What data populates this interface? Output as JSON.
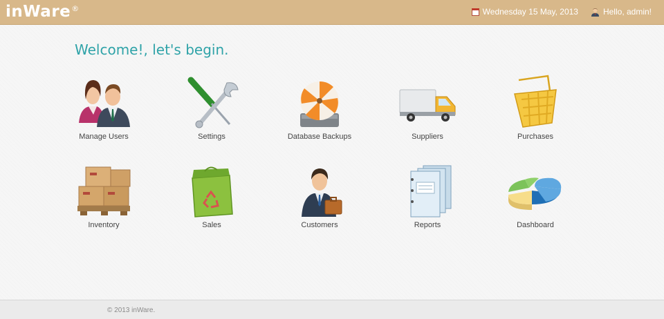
{
  "app": {
    "brand": "inWare",
    "brand_mark": "®",
    "date": "Wednesday 15 May, 2013",
    "greeting": "Hello, admin!",
    "welcome": "Welcome!, let's begin."
  },
  "tiles": [
    {
      "label": "Manage Users",
      "icon": "users-icon"
    },
    {
      "label": "Settings",
      "icon": "tools-icon"
    },
    {
      "label": "Database Backups",
      "icon": "database-backup-icon"
    },
    {
      "label": "Suppliers",
      "icon": "truck-icon"
    },
    {
      "label": "Purchases",
      "icon": "basket-icon"
    },
    {
      "label": "Inventory",
      "icon": "boxes-icon"
    },
    {
      "label": "Sales",
      "icon": "bag-icon"
    },
    {
      "label": "Customers",
      "icon": "businessman-icon"
    },
    {
      "label": "Reports",
      "icon": "binders-icon"
    },
    {
      "label": "Dashboard",
      "icon": "pie-chart-icon"
    }
  ],
  "footer": {
    "copyright": "© 2013 inWare."
  }
}
